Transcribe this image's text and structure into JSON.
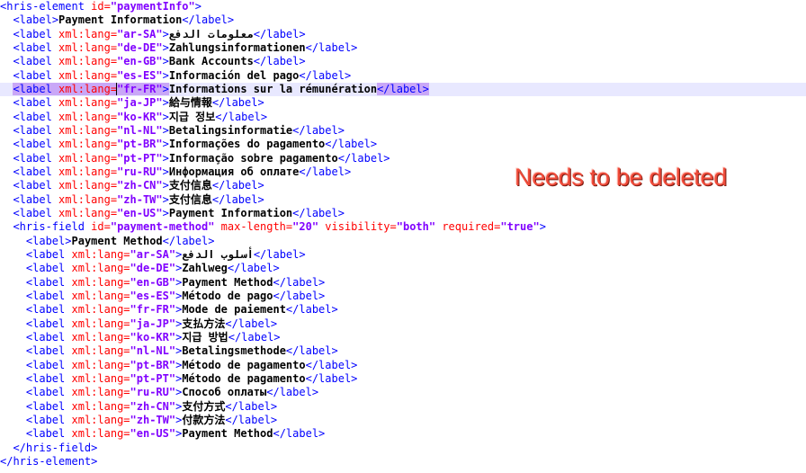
{
  "annotation": "Needs to be deleted",
  "highlight_line": 6,
  "lines": [
    {
      "indent": 0,
      "kind": "open",
      "tag": "hris-element",
      "attrs": [
        [
          "id",
          "paymentInfo"
        ]
      ]
    },
    {
      "indent": 1,
      "kind": "label",
      "text": "Payment Information"
    },
    {
      "indent": 1,
      "kind": "label",
      "lang": "ar-SA",
      "text": "معلومات الدفع"
    },
    {
      "indent": 1,
      "kind": "label",
      "lang": "de-DE",
      "text": "Zahlungsinformationen"
    },
    {
      "indent": 1,
      "kind": "label",
      "lang": "en-GB",
      "text": "Bank Accounts"
    },
    {
      "indent": 1,
      "kind": "label",
      "lang": "es-ES",
      "text": "Información del pago"
    },
    {
      "indent": 1,
      "kind": "label",
      "lang": "fr-FR",
      "text": "Informations sur la rémunération"
    },
    {
      "indent": 1,
      "kind": "label",
      "lang": "ja-JP",
      "text": "給与情報"
    },
    {
      "indent": 1,
      "kind": "label",
      "lang": "ko-KR",
      "text": "지급 정보"
    },
    {
      "indent": 1,
      "kind": "label",
      "lang": "nl-NL",
      "text": "Betalingsinformatie"
    },
    {
      "indent": 1,
      "kind": "label",
      "lang": "pt-BR",
      "text": "Informações do pagamento"
    },
    {
      "indent": 1,
      "kind": "label",
      "lang": "pt-PT",
      "text": "Informação sobre pagamento"
    },
    {
      "indent": 1,
      "kind": "label",
      "lang": "ru-RU",
      "text": "Информация об оплате"
    },
    {
      "indent": 1,
      "kind": "label",
      "lang": "zh-CN",
      "text": "支付信息"
    },
    {
      "indent": 1,
      "kind": "label",
      "lang": "zh-TW",
      "text": "支付信息"
    },
    {
      "indent": 1,
      "kind": "label",
      "lang": "en-US",
      "text": "Payment Information"
    },
    {
      "indent": 1,
      "kind": "open",
      "tag": "hris-field",
      "attrs": [
        [
          "id",
          "payment-method"
        ],
        [
          "max-length",
          "20"
        ],
        [
          "visibility",
          "both"
        ],
        [
          "required",
          "true"
        ]
      ]
    },
    {
      "indent": 2,
      "kind": "label",
      "text": "Payment Method"
    },
    {
      "indent": 2,
      "kind": "label",
      "lang": "ar-SA",
      "text": "أسلوب الدفع"
    },
    {
      "indent": 2,
      "kind": "label",
      "lang": "de-DE",
      "text": "Zahlweg"
    },
    {
      "indent": 2,
      "kind": "label",
      "lang": "en-GB",
      "text": "Payment Method"
    },
    {
      "indent": 2,
      "kind": "label",
      "lang": "es-ES",
      "text": "Método de pago"
    },
    {
      "indent": 2,
      "kind": "label",
      "lang": "fr-FR",
      "text": "Mode de paiement"
    },
    {
      "indent": 2,
      "kind": "label",
      "lang": "ja-JP",
      "text": "支払方法"
    },
    {
      "indent": 2,
      "kind": "label",
      "lang": "ko-KR",
      "text": "지급 방법"
    },
    {
      "indent": 2,
      "kind": "label",
      "lang": "nl-NL",
      "text": "Betalingsmethode"
    },
    {
      "indent": 2,
      "kind": "label",
      "lang": "pt-BR",
      "text": "Método de pagamento"
    },
    {
      "indent": 2,
      "kind": "label",
      "lang": "pt-PT",
      "text": "Método de pagamento"
    },
    {
      "indent": 2,
      "kind": "label",
      "lang": "ru-RU",
      "text": "Способ оплаты"
    },
    {
      "indent": 2,
      "kind": "label",
      "lang": "zh-CN",
      "text": "支付方式"
    },
    {
      "indent": 2,
      "kind": "label",
      "lang": "zh-TW",
      "text": "付款方法"
    },
    {
      "indent": 2,
      "kind": "label",
      "lang": "en-US",
      "text": "Payment Method"
    },
    {
      "indent": 1,
      "kind": "close",
      "tag": "hris-field"
    },
    {
      "indent": 0,
      "kind": "close",
      "tag": "hris-element"
    }
  ]
}
